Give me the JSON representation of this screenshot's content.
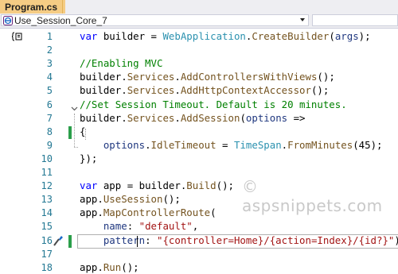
{
  "tab": {
    "title": "Program.cs",
    "close": "✕"
  },
  "navbar": {
    "project": "Use_Session_Core_7"
  },
  "lines": [
    {
      "num": "1",
      "tokens": [
        {
          "t": "var",
          "c": "kw"
        },
        {
          "t": " builder = "
        },
        {
          "t": "WebApplication",
          "c": "ty"
        },
        {
          "t": "."
        },
        {
          "t": "CreateBuilder",
          "c": "mt"
        },
        {
          "t": "("
        },
        {
          "t": "args",
          "c": "pm"
        },
        {
          "t": ");"
        }
      ]
    },
    {
      "num": "2",
      "tokens": []
    },
    {
      "num": "3",
      "tokens": [
        {
          "t": "//Enabling MVC",
          "c": "cm"
        }
      ]
    },
    {
      "num": "4",
      "tokens": [
        {
          "t": "builder."
        },
        {
          "t": "Services",
          "c": "mt"
        },
        {
          "t": "."
        },
        {
          "t": "AddControllersWithViews",
          "c": "mt"
        },
        {
          "t": "();"
        }
      ]
    },
    {
      "num": "5",
      "tokens": [
        {
          "t": "builder."
        },
        {
          "t": "Services",
          "c": "mt"
        },
        {
          "t": "."
        },
        {
          "t": "AddHttpContextAccessor",
          "c": "mt"
        },
        {
          "t": "();"
        }
      ]
    },
    {
      "num": "6",
      "tokens": [
        {
          "t": "//Set Session Timeout. Default is 20 minutes.",
          "c": "cm"
        }
      ]
    },
    {
      "num": "7",
      "tokens": [
        {
          "t": "builder."
        },
        {
          "t": "Services",
          "c": "mt"
        },
        {
          "t": "."
        },
        {
          "t": "AddSession",
          "c": "mt"
        },
        {
          "t": "("
        },
        {
          "t": "options",
          "c": "pm"
        },
        {
          "t": " =>"
        }
      ]
    },
    {
      "num": "8",
      "tokens": [
        {
          "t": "{"
        }
      ]
    },
    {
      "num": "9",
      "tokens": [
        {
          "t": "    "
        },
        {
          "t": "options",
          "c": "pm"
        },
        {
          "t": "."
        },
        {
          "t": "IdleTimeout",
          "c": "mt"
        },
        {
          "t": " = "
        },
        {
          "t": "TimeSpan",
          "c": "ty"
        },
        {
          "t": "."
        },
        {
          "t": "FromMinutes",
          "c": "mt"
        },
        {
          "t": "(45);"
        }
      ]
    },
    {
      "num": "10",
      "tokens": [
        {
          "t": "});"
        }
      ]
    },
    {
      "num": "11",
      "tokens": []
    },
    {
      "num": "12",
      "tokens": [
        {
          "t": "var",
          "c": "kw"
        },
        {
          "t": " app = builder."
        },
        {
          "t": "Build",
          "c": "mt"
        },
        {
          "t": "();"
        }
      ]
    },
    {
      "num": "13",
      "tokens": [
        {
          "t": "app."
        },
        {
          "t": "UseSession",
          "c": "mt"
        },
        {
          "t": "();"
        }
      ]
    },
    {
      "num": "14",
      "tokens": [
        {
          "t": "app."
        },
        {
          "t": "MapControllerRoute",
          "c": "mt"
        },
        {
          "t": "("
        }
      ]
    },
    {
      "num": "15",
      "tokens": [
        {
          "t": "    "
        },
        {
          "t": "name",
          "c": "pm"
        },
        {
          "t": ": "
        },
        {
          "t": "\"default\"",
          "c": "st"
        },
        {
          "t": ","
        }
      ]
    },
    {
      "num": "16",
      "tokens": [
        {
          "t": "    "
        },
        {
          "t": "pattern",
          "c": "pm"
        },
        {
          "t": ": "
        },
        {
          "t": "\"{controller=Home}/{action=Index}/{id?}\"",
          "c": "st"
        },
        {
          "t": ");"
        }
      ]
    },
    {
      "num": "17",
      "tokens": []
    },
    {
      "num": "18",
      "tokens": [
        {
          "t": "app."
        },
        {
          "t": "Run",
          "c": "mt"
        },
        {
          "t": "();"
        }
      ]
    }
  ],
  "watermark": "© aspsnippets.com",
  "colors": {
    "tab": "#f5cc84",
    "keyword": "#0000ff",
    "type": "#2b91af",
    "comment": "#008000",
    "string": "#a31515",
    "changed_bar": "#2b9e4a"
  }
}
